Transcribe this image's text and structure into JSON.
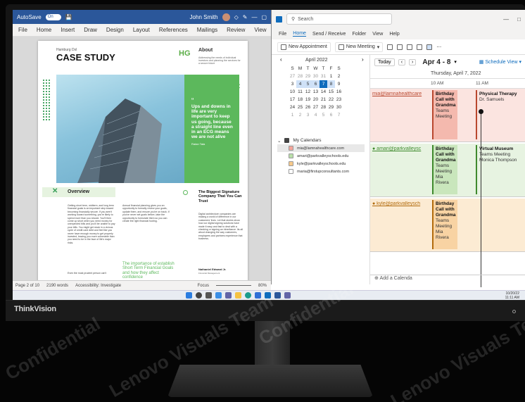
{
  "word": {
    "autosave_label": "AutoSave",
    "autosave_state": "On",
    "user_name": "John Smith",
    "menu": [
      "File",
      "Home",
      "Insert",
      "Draw",
      "Design",
      "Layout",
      "References",
      "Mailings",
      "Review",
      "View"
    ],
    "doc": {
      "kicker": "Hamburg Dsl",
      "title": "CASE STUDY",
      "logo": "HG",
      "about_heading": "About",
      "about_text": "Addressing the needs of individual investors and planning the services for a secure future",
      "quote": "Ups and downs in life are very important to keep us going, because a straight line even in an ECG means we are not alive",
      "quote_author": "Ratan Tata",
      "overview_heading": "Overview",
      "overview_col1": "Getting short term, midterm, and long term financial goals is an important step toward becoming financially secure. If you aren't working toward something, you're likely to spend more than you should. You'll then come up short when you need money for unexpected bills and you'll be unable to pay your bills. You might get stuck in a vicious cycle of credit card debt and feel like you never have enough money to get properly invested, leaving you more vulnerable than you need to be in the face of life's major risks.",
      "overview_col2": "Annual financial planning gives you an opportunity to formally review your goals, update them, and ensure you're on track. If you've never set goals before, take the opportunity to formulate them so you can create the right financial footing.",
      "side_heading": "The Biggest Signature Company That You Can Trust",
      "side_quote": "Digital architecture companies are making a world of difference in our customers' lives. Let that stories show how our digital signing solutions have made it easy and fast to deal with a checking or signing an inheritance. Its all about changing the way customers, employees and partners experience that business.",
      "side_sig": "Nathaniel Edward Jr.",
      "side_sig_role": "Financial Management",
      "callout": "The importance of establish Short Term Financial Goals and how they affect confidence",
      "footer_text": "Even the most prudent person can't"
    },
    "status": {
      "page": "Page 2 of 10",
      "words": "2190 words",
      "accessibility": "Accessibility: Investigate",
      "focus": "Focus",
      "zoom": "80%"
    }
  },
  "outlook": {
    "search_placeholder": "Search",
    "menu": [
      "File",
      "Home",
      "Send / Receive",
      "Folder",
      "View",
      "Help"
    ],
    "ribbon": {
      "new_appointment": "New Appointment",
      "new_meeting": "New Meeting"
    },
    "mini_cal": {
      "month": "April 2022",
      "weekdays": [
        "S",
        "M",
        "T",
        "W",
        "T",
        "F",
        "S"
      ],
      "weeks": [
        [
          "27",
          "28",
          "29",
          "30",
          "31",
          "1",
          "2"
        ],
        [
          "3",
          "4",
          "5",
          "6",
          "7",
          "8",
          "9"
        ],
        [
          "10",
          "11",
          "12",
          "13",
          "14",
          "15",
          "16"
        ],
        [
          "17",
          "18",
          "19",
          "20",
          "21",
          "22",
          "23"
        ],
        [
          "24",
          "25",
          "26",
          "27",
          "28",
          "29",
          "30"
        ],
        [
          "1",
          "2",
          "3",
          "4",
          "5",
          "6",
          "7"
        ]
      ]
    },
    "my_calendars_label": "My Calendars",
    "calendars": [
      {
        "name": "mia@lamnahealthcare.com",
        "color": "#f4a59a"
      },
      {
        "name": "amari@parkvalleyschools.edu",
        "color": "#b9dfa9"
      },
      {
        "name": "kyle@parkvalleyschools.edu",
        "color": "#f7c98a"
      },
      {
        "name": "maria@firstupconsultants.com",
        "color": "#ffffff"
      }
    ],
    "today_button": "Today",
    "date_range": "Apr 4 - 8",
    "schedule_view": "Schedule View",
    "day_label": "Thursday, April 7, 2022",
    "time_labels": [
      "10 AM",
      "11 AM"
    ],
    "lanes": [
      {
        "label": "mia@lamnahealthcare",
        "events": [
          {
            "title": "Birthday Call with Grandma",
            "sub": "Teams Meeting"
          },
          {
            "title": "Physical Therapy",
            "sub": "Dr. Samuels"
          }
        ]
      },
      {
        "label": "amari@parkvalleysc",
        "events": [
          {
            "title": "Birthday Call with Grandma",
            "sub": "Teams Meeting Mia Rivera"
          },
          {
            "title": "Virtual Museum",
            "sub": "Teams Meeting Monica Thompson"
          }
        ]
      },
      {
        "label": "kyle@parkvalleysch",
        "events": [
          {
            "title": "Birthday Call with Grandma",
            "sub": "Teams Meeting Mia Rivera"
          }
        ]
      }
    ],
    "add_calendar": "Add a Calenda"
  },
  "taskbar": {
    "date": "10/20/22",
    "time": "11:11 AM"
  },
  "monitor": {
    "brand": "ThinkVision"
  },
  "watermarks": [
    "Confidential",
    "Lenovo Visuals Team",
    "Lenovo Visuals Team",
    "Confidential"
  ]
}
